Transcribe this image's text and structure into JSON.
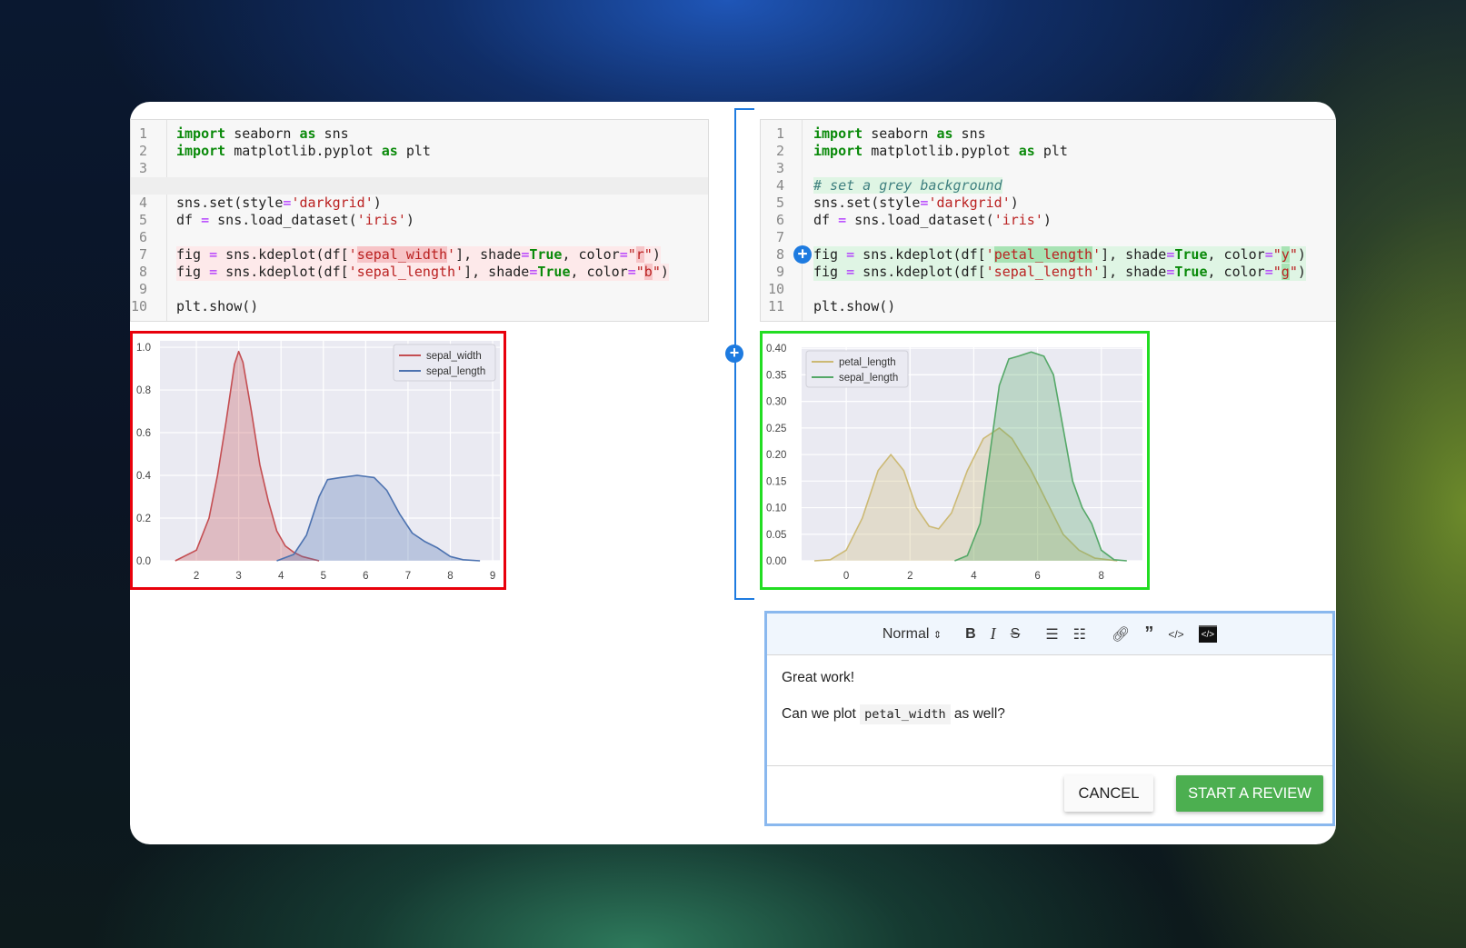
{
  "left_code": {
    "lines": [
      {
        "n": "1",
        "tokens": [
          {
            "t": "import",
            "c": "kw"
          },
          {
            "t": " seaborn "
          },
          {
            "t": "as",
            "c": "kw"
          },
          {
            "t": " sns"
          }
        ]
      },
      {
        "n": "2",
        "tokens": [
          {
            "t": "import",
            "c": "kw"
          },
          {
            "t": " matplotlib.pyplot "
          },
          {
            "t": "as",
            "c": "kw"
          },
          {
            "t": " plt"
          }
        ]
      },
      {
        "n": "3",
        "tokens": []
      },
      {
        "n": "",
        "gap": true,
        "tokens": []
      },
      {
        "n": "4",
        "tokens": [
          {
            "t": "sns.set(style"
          },
          {
            "t": "=",
            "c": "op"
          },
          {
            "t": "'darkgrid'",
            "c": "str"
          },
          {
            "t": ")"
          }
        ]
      },
      {
        "n": "5",
        "tokens": [
          {
            "t": "df "
          },
          {
            "t": "=",
            "c": "op"
          },
          {
            "t": " sns.load_dataset("
          },
          {
            "t": "'iris'",
            "c": "str"
          },
          {
            "t": ")"
          }
        ]
      },
      {
        "n": "6",
        "tokens": []
      },
      {
        "n": "7",
        "hl": "red",
        "tokens": [
          {
            "t": "fig "
          },
          {
            "t": "=",
            "c": "op"
          },
          {
            "t": " sns.kdeplot(df["
          },
          {
            "t": "'",
            "c": "str"
          },
          {
            "t": "sepal_width",
            "c": "str",
            "mark": true
          },
          {
            "t": "'",
            "c": "str"
          },
          {
            "t": "], shade"
          },
          {
            "t": "=",
            "c": "op"
          },
          {
            "t": "True",
            "c": "kw"
          },
          {
            "t": ", color"
          },
          {
            "t": "=",
            "c": "op"
          },
          {
            "t": "\"",
            "c": "str"
          },
          {
            "t": "r",
            "c": "str",
            "mark": true
          },
          {
            "t": "\"",
            "c": "str"
          },
          {
            "t": ")"
          }
        ]
      },
      {
        "n": "8",
        "hl": "red",
        "tokens": [
          {
            "t": "fig "
          },
          {
            "t": "=",
            "c": "op"
          },
          {
            "t": " sns.kdeplot(df["
          },
          {
            "t": "'sepal_length'",
            "c": "str"
          },
          {
            "t": "], shade"
          },
          {
            "t": "=",
            "c": "op"
          },
          {
            "t": "True",
            "c": "kw"
          },
          {
            "t": ", color"
          },
          {
            "t": "=",
            "c": "op"
          },
          {
            "t": "\"",
            "c": "str"
          },
          {
            "t": "b",
            "c": "str",
            "mark": true
          },
          {
            "t": "\"",
            "c": "str"
          },
          {
            "t": ")"
          }
        ]
      },
      {
        "n": "9",
        "tokens": []
      },
      {
        "n": "10",
        "tokens": [
          {
            "t": "plt.show()"
          }
        ]
      }
    ]
  },
  "right_code": {
    "lines": [
      {
        "n": "1",
        "tokens": [
          {
            "t": "import",
            "c": "kw"
          },
          {
            "t": " seaborn "
          },
          {
            "t": "as",
            "c": "kw"
          },
          {
            "t": " sns"
          }
        ]
      },
      {
        "n": "2",
        "tokens": [
          {
            "t": "import",
            "c": "kw"
          },
          {
            "t": " matplotlib.pyplot "
          },
          {
            "t": "as",
            "c": "kw"
          },
          {
            "t": " plt"
          }
        ]
      },
      {
        "n": "3",
        "tokens": []
      },
      {
        "n": "4",
        "tokens": [
          {
            "t": "# set a grey background",
            "c": "cm cmt-bg"
          }
        ]
      },
      {
        "n": "5",
        "tokens": [
          {
            "t": "sns.set(style"
          },
          {
            "t": "=",
            "c": "op"
          },
          {
            "t": "'darkgrid'",
            "c": "str"
          },
          {
            "t": ")"
          }
        ]
      },
      {
        "n": "6",
        "tokens": [
          {
            "t": "df "
          },
          {
            "t": "=",
            "c": "op"
          },
          {
            "t": " sns.load_dataset("
          },
          {
            "t": "'iris'",
            "c": "str"
          },
          {
            "t": ")"
          }
        ]
      },
      {
        "n": "7",
        "tokens": []
      },
      {
        "n": "8",
        "hl": "green",
        "plus": true,
        "tokens": [
          {
            "t": "fig "
          },
          {
            "t": "=",
            "c": "op"
          },
          {
            "t": " sns.kdeplot(df["
          },
          {
            "t": "'",
            "c": "str"
          },
          {
            "t": "petal_length",
            "c": "str",
            "mark": true
          },
          {
            "t": "'",
            "c": "str"
          },
          {
            "t": "], shade"
          },
          {
            "t": "=",
            "c": "op"
          },
          {
            "t": "True",
            "c": "kw"
          },
          {
            "t": ", color"
          },
          {
            "t": "=",
            "c": "op"
          },
          {
            "t": "\"",
            "c": "str"
          },
          {
            "t": "y",
            "c": "str",
            "mark": true
          },
          {
            "t": "\"",
            "c": "str"
          },
          {
            "t": ")"
          }
        ]
      },
      {
        "n": "9",
        "hl": "green",
        "tokens": [
          {
            "t": "fig "
          },
          {
            "t": "=",
            "c": "op"
          },
          {
            "t": " sns.kdeplot(df["
          },
          {
            "t": "'sepal_length'",
            "c": "str"
          },
          {
            "t": "], shade"
          },
          {
            "t": "=",
            "c": "op"
          },
          {
            "t": "True",
            "c": "kw"
          },
          {
            "t": ", color"
          },
          {
            "t": "=",
            "c": "op"
          },
          {
            "t": "\"",
            "c": "str"
          },
          {
            "t": "g",
            "c": "str",
            "mark": true
          },
          {
            "t": "\"",
            "c": "str"
          },
          {
            "t": ")"
          }
        ]
      },
      {
        "n": "10",
        "tokens": []
      },
      {
        "n": "11",
        "tokens": [
          {
            "t": "plt.show()"
          }
        ]
      }
    ]
  },
  "highlight_colors": {
    "removed_border": "#e8000b",
    "added_border": "#22dd22",
    "comment_border": "#8ab8ee",
    "bracket": "#1e7be0"
  },
  "chart_data": [
    {
      "type": "area",
      "xlim": [
        1.14,
        9.17
      ],
      "ylim": [
        0,
        1.03
      ],
      "xticks": [
        "2",
        "3",
        "4",
        "5",
        "6",
        "7",
        "8",
        "9"
      ],
      "yticks": [
        "0.0",
        "0.2",
        "0.4",
        "0.6",
        "0.8",
        "1.0"
      ],
      "grid": true,
      "legend": "top-right",
      "series": [
        {
          "name": "sepal_width",
          "color": "#c44e52",
          "x": [
            1.5,
            2.0,
            2.3,
            2.5,
            2.7,
            2.9,
            3.0,
            3.1,
            3.3,
            3.5,
            3.7,
            3.9,
            4.1,
            4.3,
            4.5,
            4.9
          ],
          "y": [
            0,
            0.05,
            0.2,
            0.4,
            0.65,
            0.92,
            0.98,
            0.93,
            0.7,
            0.45,
            0.28,
            0.14,
            0.07,
            0.04,
            0.02,
            0
          ]
        },
        {
          "name": "sepal_length",
          "color": "#4c72b0",
          "x": [
            3.9,
            4.3,
            4.6,
            4.9,
            5.1,
            5.4,
            5.8,
            6.2,
            6.5,
            6.8,
            7.1,
            7.4,
            7.7,
            8.0,
            8.3,
            8.7
          ],
          "y": [
            0,
            0.03,
            0.12,
            0.3,
            0.38,
            0.39,
            0.4,
            0.39,
            0.33,
            0.22,
            0.13,
            0.09,
            0.06,
            0.02,
            0.005,
            0
          ]
        }
      ]
    },
    {
      "type": "area",
      "xlim": [
        -1.4,
        9.29
      ],
      "ylim": [
        0,
        0.402
      ],
      "xticks": [
        "0",
        "2",
        "4",
        "6",
        "8"
      ],
      "yticks": [
        "0.00",
        "0.05",
        "0.10",
        "0.15",
        "0.20",
        "0.25",
        "0.30",
        "0.35",
        "0.40"
      ],
      "grid": true,
      "legend": "top-left",
      "series": [
        {
          "name": "petal_length",
          "color": "#ccb974",
          "x": [
            -1.0,
            -0.5,
            0,
            0.5,
            1.0,
            1.4,
            1.8,
            2.2,
            2.6,
            2.9,
            3.3,
            3.8,
            4.3,
            4.8,
            5.2,
            5.8,
            6.3,
            6.8,
            7.3,
            7.8,
            8.5
          ],
          "y": [
            0,
            0.002,
            0.02,
            0.08,
            0.17,
            0.2,
            0.17,
            0.1,
            0.065,
            0.06,
            0.09,
            0.17,
            0.23,
            0.25,
            0.23,
            0.17,
            0.11,
            0.05,
            0.02,
            0.005,
            0
          ]
        },
        {
          "name": "sepal_length",
          "color": "#55a868",
          "x": [
            3.4,
            3.8,
            4.2,
            4.5,
            4.8,
            5.1,
            5.4,
            5.8,
            6.2,
            6.5,
            6.8,
            7.1,
            7.4,
            7.7,
            8.0,
            8.4,
            8.8
          ],
          "y": [
            0,
            0.01,
            0.07,
            0.2,
            0.33,
            0.38,
            0.385,
            0.393,
            0.385,
            0.35,
            0.25,
            0.15,
            0.1,
            0.07,
            0.02,
            0.002,
            0
          ]
        }
      ]
    }
  ],
  "comment": {
    "toolbar": {
      "format_select": "Normal",
      "icons": [
        "bold-icon",
        "italic-icon",
        "strikethrough-icon",
        "ordered-list-icon",
        "bullet-list-icon",
        "link-icon",
        "quote-icon",
        "code-icon",
        "code-block-icon"
      ]
    },
    "paragraph1": "Great work!",
    "paragraph2_before": "Can we plot",
    "paragraph2_code": "petal_width",
    "paragraph2_after": "as well?",
    "cancel_label": "CANCEL",
    "submit_label": "START A REVIEW"
  }
}
